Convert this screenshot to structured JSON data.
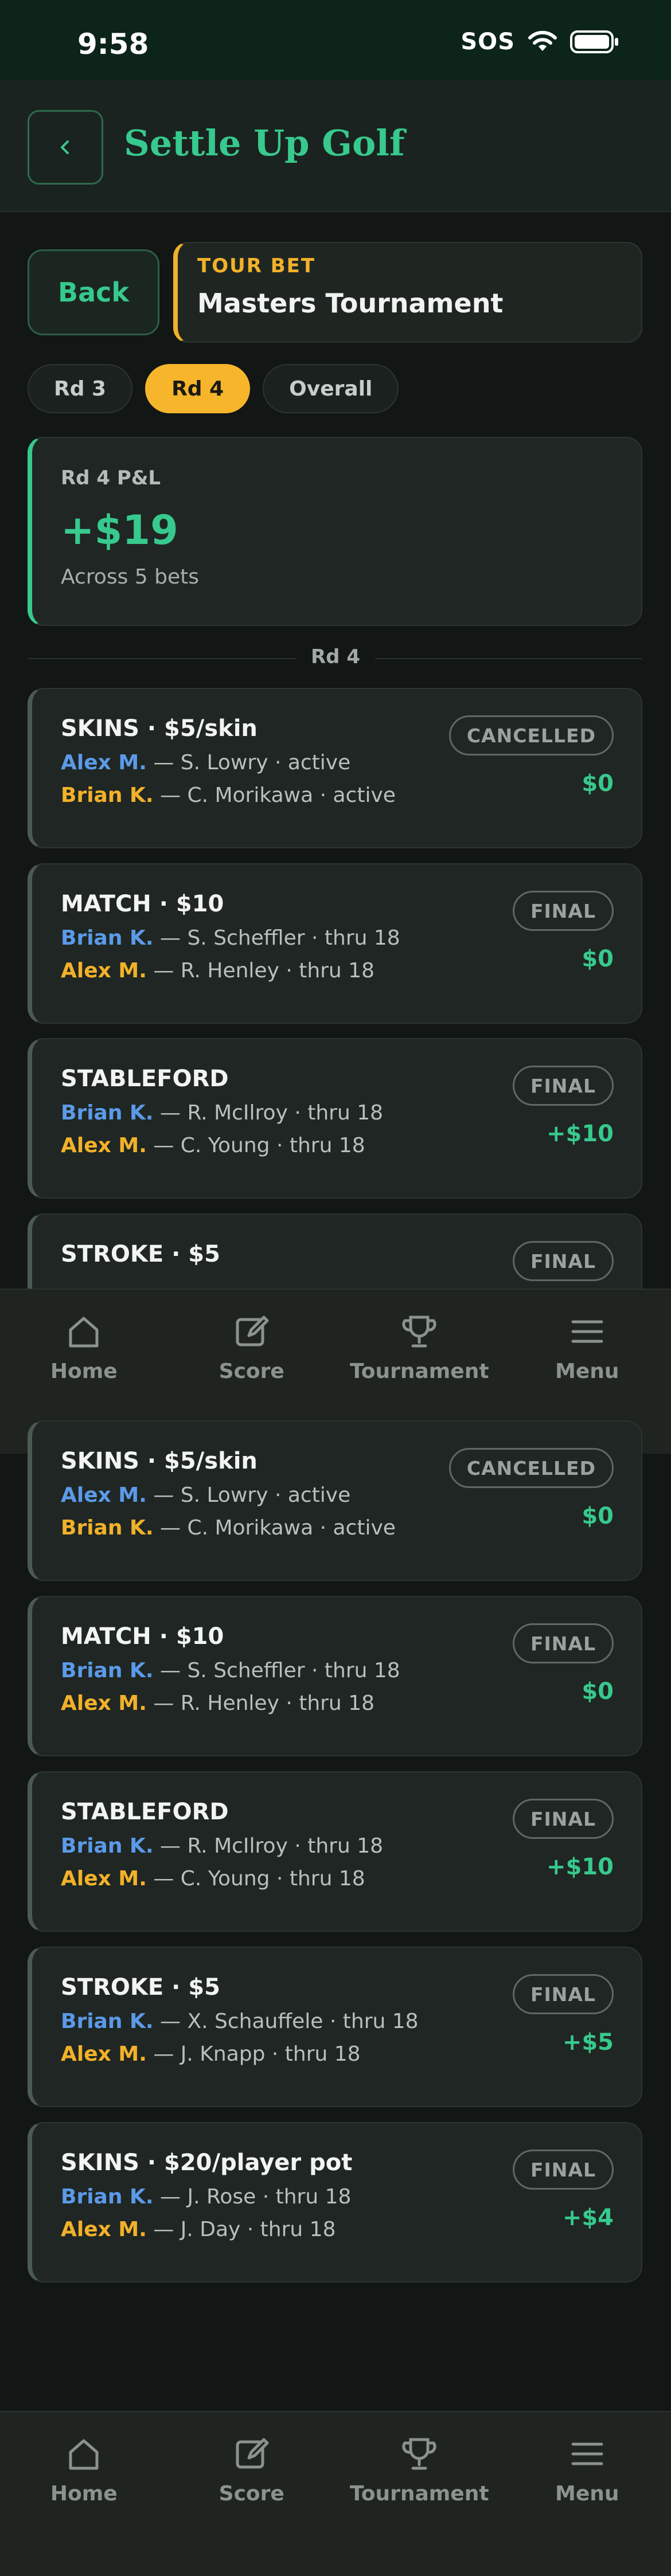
{
  "status_bar": {
    "time": "9:58",
    "sos": "SOS"
  },
  "header": {
    "back_icon": "chevron-left-icon",
    "title": "Settle Up Golf"
  },
  "back_button": {
    "label": "Back"
  },
  "tour_bet": {
    "label": "TOUR BET",
    "name": "Masters Tournament"
  },
  "round_tabs": [
    {
      "label": "Rd 3",
      "active": false
    },
    {
      "label": "Rd 4",
      "active": true
    },
    {
      "label": "Overall",
      "active": false
    }
  ],
  "pnl": {
    "label": "Rd 4 P&L",
    "value": "+$19",
    "subtitle": "Across 5 bets"
  },
  "section_label": "Rd 4",
  "bets_top": [
    {
      "title": "SKINS · $5/skin",
      "status": "CANCELLED",
      "amount": "$0",
      "lines": [
        {
          "player": "Alex M.",
          "color": "blue",
          "detail": " — S. Lowry · active"
        },
        {
          "player": "Brian K.",
          "color": "gold",
          "detail": " — C. Morikawa · active"
        }
      ]
    },
    {
      "title": "MATCH · $10",
      "status": "FINAL",
      "amount": "$0",
      "lines": [
        {
          "player": "Brian K.",
          "color": "blue",
          "detail": " — S. Scheffler · thru 18"
        },
        {
          "player": "Alex M.",
          "color": "gold",
          "detail": " — R. Henley · thru 18"
        }
      ]
    },
    {
      "title": "STABLEFORD",
      "status": "FINAL",
      "amount": "+$10",
      "lines": [
        {
          "player": "Brian K.",
          "color": "blue",
          "detail": " — R. McIlroy · thru 18"
        },
        {
          "player": "Alex M.",
          "color": "gold",
          "detail": " — C. Young · thru 18"
        }
      ]
    },
    {
      "title": "STROKE · $5",
      "status": "FINAL",
      "amount": "",
      "lines": []
    }
  ],
  "bets_full": [
    {
      "title": "SKINS · $5/skin",
      "status": "CANCELLED",
      "amount": "$0",
      "lines": [
        {
          "player": "Alex M.",
          "color": "blue",
          "detail": " — S. Lowry · active"
        },
        {
          "player": "Brian K.",
          "color": "gold",
          "detail": " — C. Morikawa · active"
        }
      ]
    },
    {
      "title": "MATCH · $10",
      "status": "FINAL",
      "amount": "$0",
      "lines": [
        {
          "player": "Brian K.",
          "color": "blue",
          "detail": " — S. Scheffler · thru 18"
        },
        {
          "player": "Alex M.",
          "color": "gold",
          "detail": " — R. Henley · thru 18"
        }
      ]
    },
    {
      "title": "STABLEFORD",
      "status": "FINAL",
      "amount": "+$10",
      "lines": [
        {
          "player": "Brian K.",
          "color": "blue",
          "detail": " — R. McIlroy · thru 18"
        },
        {
          "player": "Alex M.",
          "color": "gold",
          "detail": " — C. Young · thru 18"
        }
      ]
    },
    {
      "title": "STROKE · $5",
      "status": "FINAL",
      "amount": "+$5",
      "lines": [
        {
          "player": "Brian K.",
          "color": "blue",
          "detail": " — X. Schauffele · thru 18"
        },
        {
          "player": "Alex M.",
          "color": "gold",
          "detail": " — J. Knapp · thru 18"
        }
      ]
    },
    {
      "title": "SKINS · $20/player pot",
      "status": "FINAL",
      "amount": "+$4",
      "lines": [
        {
          "player": "Brian K.",
          "color": "blue",
          "detail": " — J. Rose · thru 18"
        },
        {
          "player": "Alex M.",
          "color": "gold",
          "detail": " — J. Day · thru 18"
        }
      ]
    }
  ],
  "nav": [
    {
      "label": "Home",
      "icon": "home-icon"
    },
    {
      "label": "Score",
      "icon": "edit-icon"
    },
    {
      "label": "Tournament",
      "icon": "trophy-icon"
    },
    {
      "label": "Menu",
      "icon": "menu-icon"
    }
  ],
  "colors": {
    "accent_green": "#37c98d",
    "accent_gold": "#f2b12a",
    "player_blue": "#5b9ae8",
    "background": "#121614"
  }
}
